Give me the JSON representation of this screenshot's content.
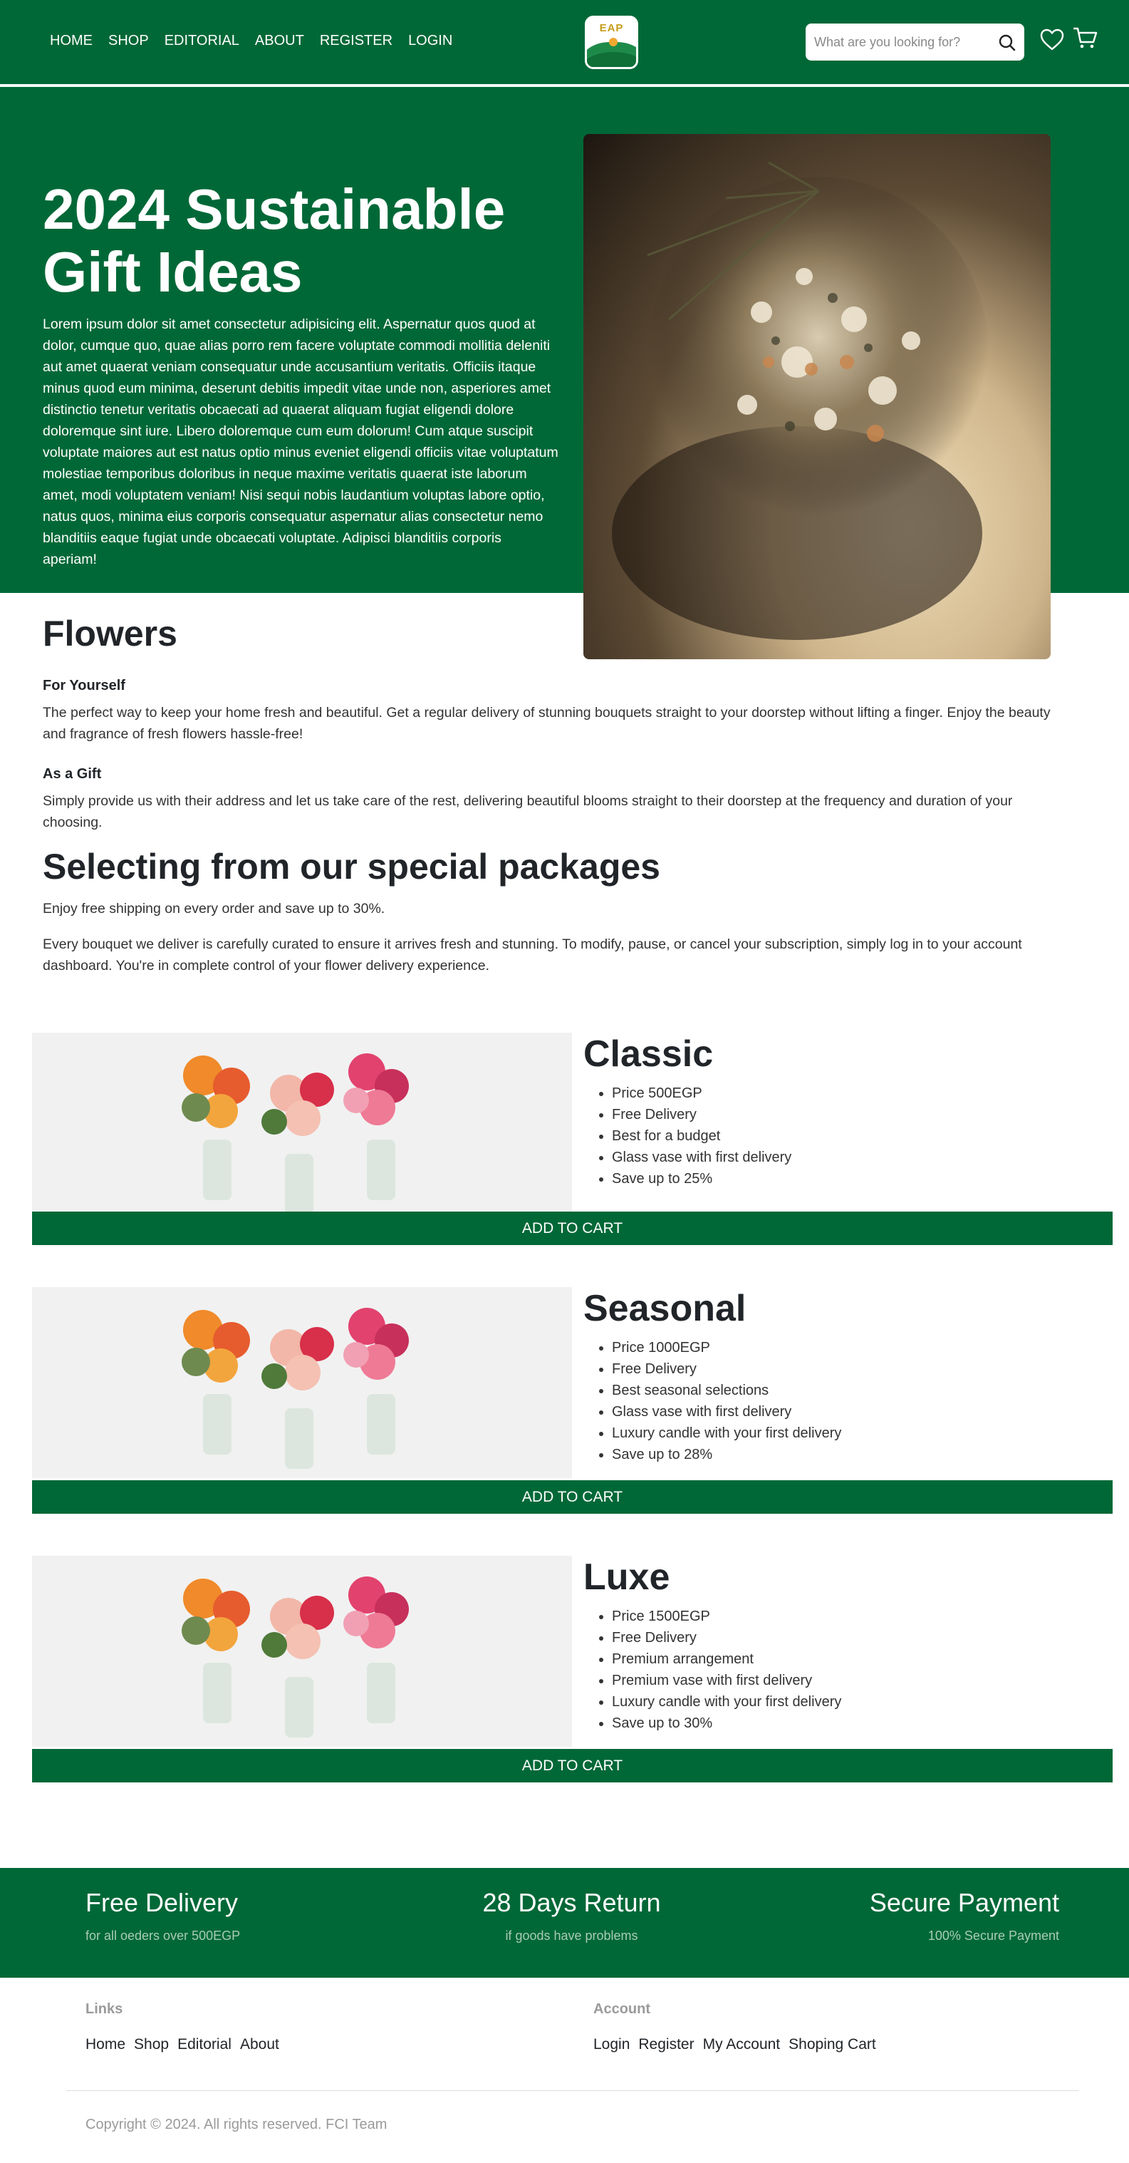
{
  "header": {
    "nav": [
      "HOME",
      "SHOP",
      "EDITORIAL",
      "ABOUT",
      "REGISTER",
      "LOGIN"
    ],
    "logo_text": "EAP",
    "search_placeholder": "What are you looking for?"
  },
  "hero": {
    "title": "2024 Sustainable Gift Ideas",
    "text": "Lorem ipsum dolor sit amet consectetur adipisicing elit. Aspernatur quos quod at dolor, cumque quo, quae alias porro rem facere voluptate commodi mollitia deleniti aut amet quaerat veniam consequatur unde accusantium veritatis. Officiis itaque minus quod eum minima, deserunt debitis impedit vitae unde non, asperiores amet distinctio tenetur veritatis obcaecati ad quaerat aliquam fugiat eligendi dolore doloremque sint iure. Libero doloremque cum eum dolorum! Cum atque suscipit voluptate maiores aut est natus optio minus eveniet eligendi officiis vitae voluptatum molestiae temporibus doloribus in neque maxime veritatis quaerat iste laborum amet, modi voluptatem veniam! Nisi sequi nobis laudantium voluptas labore optio, natus quos, minima eius corporis consequatur aspernatur alias consectetur nemo blanditiis eaque fugiat unde obcaecati voluptate. Adipisci blanditiis corporis aperiam!"
  },
  "flowers": {
    "title": "Flowers",
    "for_yourself_title": "For Yourself",
    "for_yourself_text": "The perfect way to keep your home fresh and beautiful. Get a regular delivery of stunning bouquets straight to your doorstep without lifting a finger. Enjoy the beauty and fragrance of fresh flowers hassle-free!",
    "as_gift_title": "As a Gift",
    "as_gift_text": "Simply provide us with their address and let us take care of the rest, delivering beautiful blooms straight to their doorstep at the frequency and duration of your choosing."
  },
  "packages_intro": {
    "title": "Selecting from our special packages",
    "line1": "Enjoy free shipping on every order and save up to 30%.",
    "line2": "Every bouquet we deliver is carefully curated to ensure it arrives fresh and stunning. To modify, pause, or cancel your subscription, simply log in to your account dashboard. You're in complete control of your flower delivery experience."
  },
  "packages": [
    {
      "title": "Classic",
      "features": [
        "Price 500EGP",
        "Free Delivery",
        "Best for a budget",
        "Glass vase with first delivery",
        "Save up to 25%"
      ],
      "button": "ADD TO CART"
    },
    {
      "title": "Seasonal",
      "features": [
        "Price 1000EGP",
        "Free Delivery",
        "Best seasonal selections",
        "Glass vase with first delivery",
        "Luxury candle with your first delivery",
        "Save up to 28%"
      ],
      "button": "ADD TO CART"
    },
    {
      "title": "Luxe",
      "features": [
        "Price 1500EGP",
        "Free Delivery",
        "Premium arrangement",
        "Premium vase with first delivery",
        "Luxury candle with your first delivery",
        "Save up to 30%"
      ],
      "button": "ADD TO CART"
    }
  ],
  "features_bar": [
    {
      "title": "Free Delivery",
      "subtitle": "for all oeders over 500EGP"
    },
    {
      "title": "28 Days Return",
      "subtitle": "if goods have problems"
    },
    {
      "title": "Secure Payment",
      "subtitle": "100% Secure Payment"
    }
  ],
  "footer": {
    "links_title": "Links",
    "links": [
      "Home",
      "Shop",
      "Editorial",
      "About"
    ],
    "account_title": "Account",
    "account_links": [
      "Login",
      "Register",
      "My Account",
      "Shoping Cart"
    ],
    "copyright": "Copyright © 2024. All rights reserved. FCI Team"
  },
  "colors": {
    "brand_green": "#006837",
    "white": "#ffffff",
    "text_dark": "#212529",
    "muted": "#9a9a9a"
  },
  "icons": [
    "search-icon",
    "heart-icon",
    "cart-icon"
  ]
}
